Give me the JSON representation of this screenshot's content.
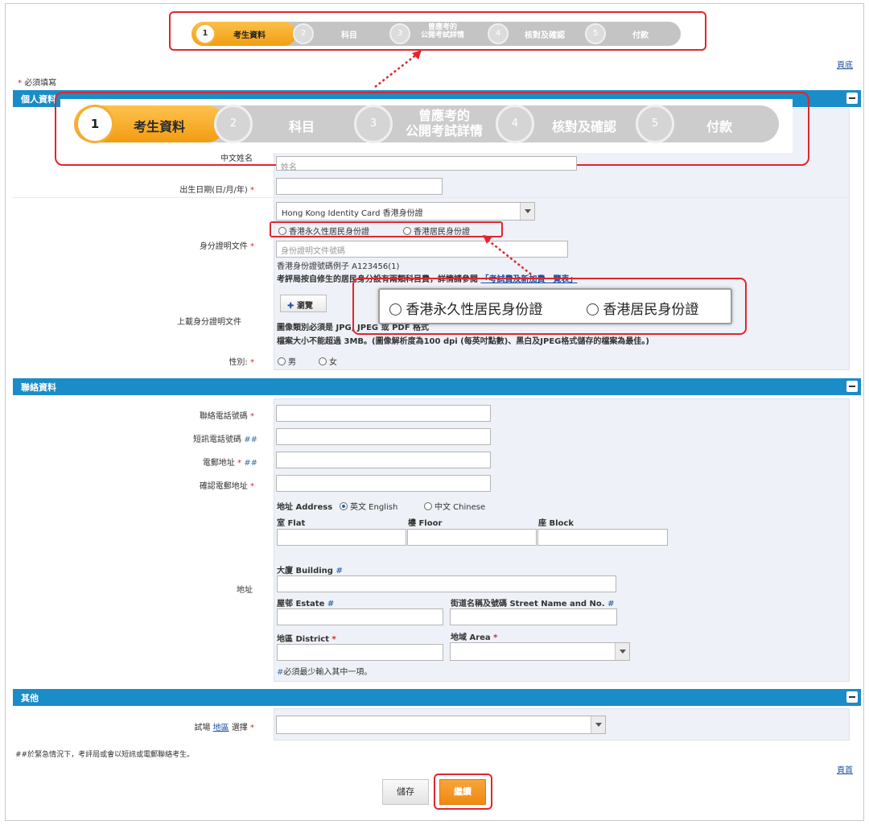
{
  "steps": [
    {
      "num": "1",
      "label": "考生資料"
    },
    {
      "num": "2",
      "label": "科目"
    },
    {
      "num": "3",
      "label_line1": "曾應考的",
      "label_line2": "公開考試詳情"
    },
    {
      "num": "4",
      "label": "核對及確認"
    },
    {
      "num": "5",
      "label": "付款"
    }
  ],
  "top_link": "頁底",
  "bottom_link": "頁首",
  "required_note": "必須填寫",
  "sections": {
    "personal": "個人資料",
    "contact": "聯絡資料",
    "other": "其他"
  },
  "personal": {
    "chinese_name_label": "中文姓名",
    "chinese_name_placeholder": "姓名",
    "dob_label": "出生日期(日/月/年)",
    "id_label": "身分證明文件",
    "id_type": "Hong Kong Identity Card 香港身份證",
    "resident_perm": "香港永久性居民身份證",
    "resident": "香港居民身份證",
    "id_placeholder": "身份證明文件號碼",
    "id_example": "香港身份證號碼例子 A123456(1)",
    "id_note": "考評局按自修生的居民身分設有兩類科目費，詳情請參閱",
    "id_note_link": "「考試費及新加費一覽表」",
    "upload_label": "上載身分證明文件",
    "browse": "瀏覽",
    "upload_note1": "圖像類別必須是 JPG, JPEG 或 PDF 格式",
    "upload_note2": "檔案大小不能超過 3MB。(圖像解析度為100 dpi (每英吋點數)、黑白及JPEG格式儲存的檔案為最佳。)",
    "gender_label": "性別:",
    "male": "男",
    "female": "女"
  },
  "zoom": {
    "perm": "香港永久性居民身份證",
    "res": "香港居民身份證"
  },
  "contact": {
    "phone_label": "聯絡電話號碼",
    "sms_label": "短訊電話號碼",
    "email_label": "電郵地址",
    "email_confirm_label": "確認電郵地址",
    "address_label": "地址",
    "address_lang_label": "地址 Address",
    "lang_en": "英文 English",
    "lang_zh": "中文 Chinese",
    "flat": "室 Flat",
    "floor": "樓 Floor",
    "block": "座 Block",
    "building": "大廈 Building",
    "estate": "屋邨 Estate",
    "street": "街道名稱及號碼 Street Name and No.",
    "district": "地區 District",
    "area": "地域 Area",
    "must_one": "必須最少輸入其中一項。"
  },
  "other": {
    "venue_label1": "試場",
    "venue_label_link": "地區",
    "venue_label2": "選擇"
  },
  "footnote": "##於緊急情況下，考評局或會以短訊或電郵聯絡考生。",
  "buttons": {
    "save": "儲存",
    "continue": "繼續"
  },
  "colors": {
    "accent_orange": "#f39c12",
    "section_blue": "#1a8cc7",
    "highlight_red": "#e0262f"
  }
}
